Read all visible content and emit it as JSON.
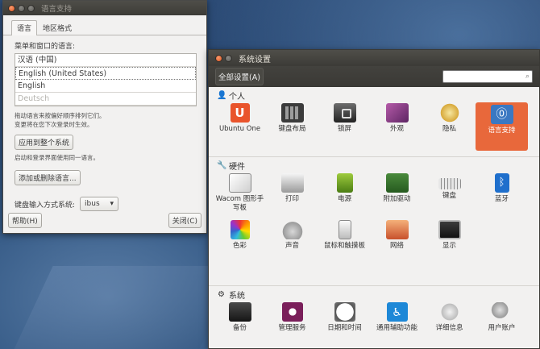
{
  "lang_window": {
    "title": "语言支持",
    "tabs": [
      "语言",
      "地区格式"
    ],
    "menu_label": "菜单和窗口的语言:",
    "languages": [
      "汉语 (中国)",
      "English (United States)",
      "English",
      "Deutsch"
    ],
    "hint_line1": "拖动语言来按偏好顺序排列它们。",
    "hint_line2": "变更将在您下次登录时生效。",
    "apply_button": "应用到整个系统",
    "apply_hint": "启动和登录界面使用同一语言。",
    "add_remove_button": "添加或删除语言...",
    "im_label": "键盘输入方式系统:",
    "im_value": "ibus",
    "help_button": "帮助(H)",
    "close_button": "关闭(C)"
  },
  "settings_window": {
    "title": "系统设置",
    "all_settings": "全部设置(A)",
    "search_placeholder": "",
    "sections": [
      {
        "title": "个人",
        "icon": "person-icon",
        "items": [
          {
            "label": "Ubuntu One",
            "icon": "ubuntu-one-icon"
          },
          {
            "label": "键盘布局",
            "icon": "keyboard-layout-icon"
          },
          {
            "label": "锁屏",
            "icon": "lock-screen-icon"
          },
          {
            "label": "外观",
            "icon": "appearance-icon"
          },
          {
            "label": "隐私",
            "icon": "privacy-icon"
          },
          {
            "label": "语言支持",
            "icon": "language-support-icon",
            "selected": true
          }
        ]
      },
      {
        "title": "硬件",
        "icon": "wrench-icon",
        "items": [
          {
            "label": "Wacom 图形手写板",
            "icon": "wacom-icon"
          },
          {
            "label": "打印",
            "icon": "printer-icon"
          },
          {
            "label": "电源",
            "icon": "power-icon"
          },
          {
            "label": "附加驱动",
            "icon": "additional-drivers-icon"
          },
          {
            "label": "键盘",
            "icon": "keyboard-icon"
          },
          {
            "label": "蓝牙",
            "icon": "bluetooth-icon"
          },
          {
            "label": "色彩",
            "icon": "color-icon"
          },
          {
            "label": "声音",
            "icon": "sound-icon"
          },
          {
            "label": "鼠标和触摸板",
            "icon": "mouse-icon"
          },
          {
            "label": "网络",
            "icon": "network-icon"
          },
          {
            "label": "显示",
            "icon": "display-icon"
          }
        ]
      },
      {
        "title": "系统",
        "icon": "system-icon",
        "items": [
          {
            "label": "备份",
            "icon": "backup-icon"
          },
          {
            "label": "管理服务",
            "icon": "management-service-icon"
          },
          {
            "label": "日期和时间",
            "icon": "clock-icon"
          },
          {
            "label": "通用辅助功能",
            "icon": "accessibility-icon"
          },
          {
            "label": "详细信息",
            "icon": "details-icon"
          },
          {
            "label": "用户账户",
            "icon": "users-icon"
          }
        ]
      }
    ]
  },
  "colors": {
    "accent": "#e8683b",
    "titlebar": "#3c3b37",
    "window_bg": "#f2f1f0",
    "close_button": "#e0541d"
  }
}
